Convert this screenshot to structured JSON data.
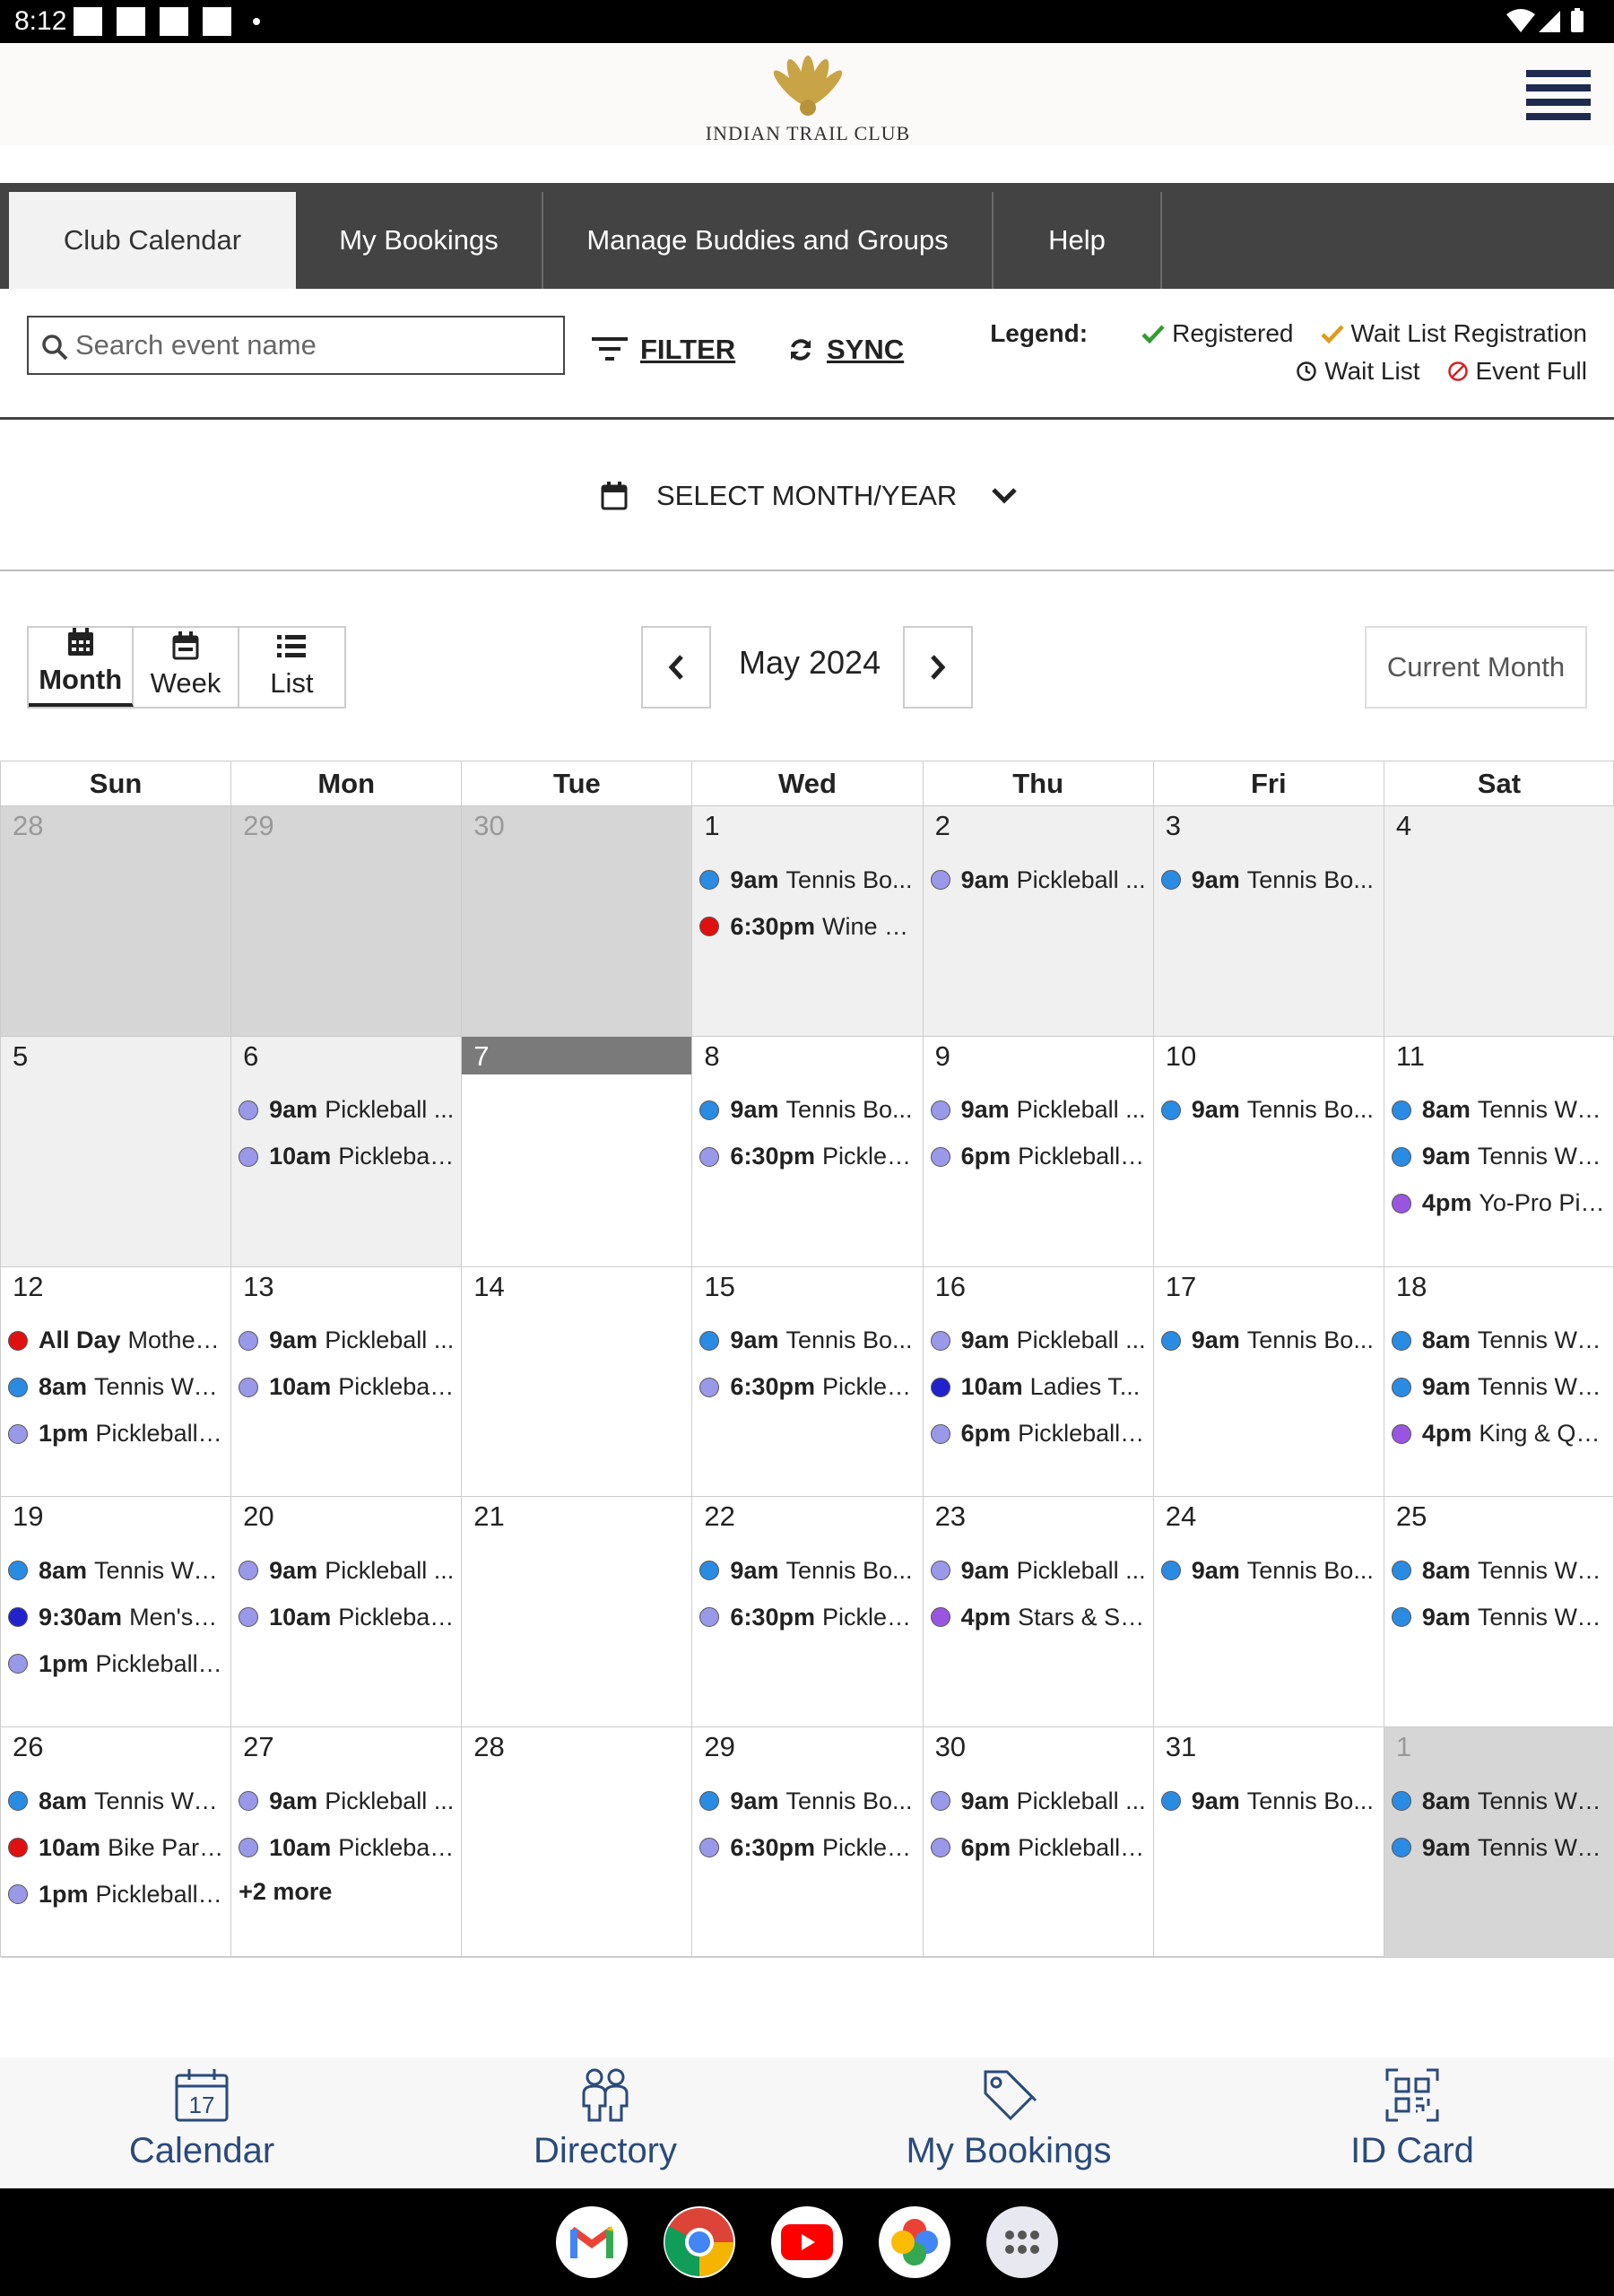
{
  "status_bar": {
    "time": "8:12"
  },
  "header": {
    "logo_text": "INDIAN TRAIL CLUB"
  },
  "tabs": [
    {
      "label": "Club Calendar"
    },
    {
      "label": "My Bookings"
    },
    {
      "label": "Manage Buddies and Groups"
    },
    {
      "label": "Help"
    }
  ],
  "toolbar": {
    "search_placeholder": "Search event name",
    "filter_label": "FILTER",
    "sync_label": "SYNC"
  },
  "legend": {
    "title": "Legend:",
    "items": [
      {
        "label": "Registered",
        "icon": "check-icon",
        "color": "#2e9e2e"
      },
      {
        "label": "Wait List Registration",
        "icon": "check-icon",
        "color": "#e09a1a"
      },
      {
        "label": "Wait List",
        "icon": "clock-icon",
        "color": "#222222"
      },
      {
        "label": "Event Full",
        "icon": "no-entry-icon",
        "color": "#d62020"
      }
    ]
  },
  "month_selector": {
    "label": "SELECT MONTH/YEAR"
  },
  "view_switch": {
    "month": "Month",
    "week": "Week",
    "list": "List"
  },
  "calendar": {
    "current_month": "May 2024",
    "current_month_button": "Current Month",
    "weekdays": [
      "Sun",
      "Mon",
      "Tue",
      "Wed",
      "Thu",
      "Fri",
      "Sat"
    ],
    "colors": {
      "blue": "#2a8be3",
      "lavender": "#9a98e8",
      "red": "#e01010",
      "navy": "#2222cc",
      "purple": "#9a55e0"
    },
    "weeks": [
      [
        {
          "day": "28",
          "outside": true,
          "events": []
        },
        {
          "day": "29",
          "outside": true,
          "events": []
        },
        {
          "day": "30",
          "outside": true,
          "events": []
        },
        {
          "day": "1",
          "events": [
            {
              "time": "9am",
              "title": "Tennis Bo...",
              "color": "blue"
            },
            {
              "time": "6:30pm",
              "title": "Wine D...",
              "color": "red"
            }
          ]
        },
        {
          "day": "2",
          "events": [
            {
              "time": "9am",
              "title": "Pickleball ...",
              "color": "lavender"
            }
          ]
        },
        {
          "day": "3",
          "events": [
            {
              "time": "9am",
              "title": "Tennis Bo...",
              "color": "blue"
            }
          ]
        },
        {
          "day": "4",
          "events": []
        }
      ],
      [
        {
          "day": "5",
          "events": []
        },
        {
          "day": "6",
          "events": [
            {
              "time": "9am",
              "title": "Pickleball ...",
              "color": "lavender"
            },
            {
              "time": "10am",
              "title": "Pickleball...",
              "color": "lavender"
            }
          ]
        },
        {
          "day": "7",
          "today": true,
          "events": []
        },
        {
          "day": "8",
          "events": [
            {
              "time": "9am",
              "title": "Tennis Bo...",
              "color": "blue"
            },
            {
              "time": "6:30pm",
              "title": "Pickleb...",
              "color": "lavender"
            }
          ]
        },
        {
          "day": "9",
          "events": [
            {
              "time": "9am",
              "title": "Pickleball ...",
              "color": "lavender"
            },
            {
              "time": "6pm",
              "title": "Pickleball ...",
              "color": "lavender"
            }
          ]
        },
        {
          "day": "10",
          "events": [
            {
              "time": "9am",
              "title": "Tennis Bo...",
              "color": "blue"
            }
          ]
        },
        {
          "day": "11",
          "events": [
            {
              "time": "8am",
              "title": "Tennis We...",
              "color": "blue"
            },
            {
              "time": "9am",
              "title": "Tennis We...",
              "color": "blue"
            },
            {
              "time": "4pm",
              "title": "Yo-Pro Pic...",
              "color": "purple"
            }
          ]
        }
      ],
      [
        {
          "day": "12",
          "events": [
            {
              "time": "All Day",
              "title": "Mother'...",
              "color": "red"
            },
            {
              "time": "8am",
              "title": "Tennis We...",
              "color": "blue"
            },
            {
              "time": "1pm",
              "title": "Pickleball ...",
              "color": "lavender"
            }
          ]
        },
        {
          "day": "13",
          "events": [
            {
              "time": "9am",
              "title": "Pickleball ...",
              "color": "lavender"
            },
            {
              "time": "10am",
              "title": "Pickleball...",
              "color": "lavender"
            }
          ]
        },
        {
          "day": "14",
          "events": []
        },
        {
          "day": "15",
          "events": [
            {
              "time": "9am",
              "title": "Tennis Bo...",
              "color": "blue"
            },
            {
              "time": "6:30pm",
              "title": "Pickleb...",
              "color": "lavender"
            }
          ]
        },
        {
          "day": "16",
          "events": [
            {
              "time": "9am",
              "title": "Pickleball ...",
              "color": "lavender"
            },
            {
              "time": "10am",
              "title": "Ladies T...",
              "color": "navy"
            },
            {
              "time": "6pm",
              "title": "Pickleball ...",
              "color": "lavender"
            }
          ]
        },
        {
          "day": "17",
          "events": [
            {
              "time": "9am",
              "title": "Tennis Bo...",
              "color": "blue"
            }
          ]
        },
        {
          "day": "18",
          "events": [
            {
              "time": "8am",
              "title": "Tennis We...",
              "color": "blue"
            },
            {
              "time": "9am",
              "title": "Tennis We...",
              "color": "blue"
            },
            {
              "time": "4pm",
              "title": "King & Qu...",
              "color": "purple"
            }
          ]
        }
      ],
      [
        {
          "day": "19",
          "events": [
            {
              "time": "8am",
              "title": "Tennis We...",
              "color": "blue"
            },
            {
              "time": "9:30am",
              "title": "Men's T...",
              "color": "navy"
            },
            {
              "time": "1pm",
              "title": "Pickleball ...",
              "color": "lavender"
            }
          ]
        },
        {
          "day": "20",
          "events": [
            {
              "time": "9am",
              "title": "Pickleball ...",
              "color": "lavender"
            },
            {
              "time": "10am",
              "title": "Pickleball...",
              "color": "lavender"
            }
          ]
        },
        {
          "day": "21",
          "events": []
        },
        {
          "day": "22",
          "events": [
            {
              "time": "9am",
              "title": "Tennis Bo...",
              "color": "blue"
            },
            {
              "time": "6:30pm",
              "title": "Pickleb...",
              "color": "lavender"
            }
          ]
        },
        {
          "day": "23",
          "events": [
            {
              "time": "9am",
              "title": "Pickleball ...",
              "color": "lavender"
            },
            {
              "time": "4pm",
              "title": "Stars & Str...",
              "color": "purple"
            }
          ]
        },
        {
          "day": "24",
          "events": [
            {
              "time": "9am",
              "title": "Tennis Bo...",
              "color": "blue"
            }
          ]
        },
        {
          "day": "25",
          "events": [
            {
              "time": "8am",
              "title": "Tennis We...",
              "color": "blue"
            },
            {
              "time": "9am",
              "title": "Tennis We...",
              "color": "blue"
            }
          ]
        }
      ],
      [
        {
          "day": "26",
          "events": [
            {
              "time": "8am",
              "title": "Tennis We...",
              "color": "blue"
            },
            {
              "time": "10am",
              "title": "Bike Para...",
              "color": "red"
            },
            {
              "time": "1pm",
              "title": "Pickleball ...",
              "color": "lavender"
            }
          ]
        },
        {
          "day": "27",
          "more": "+2 more",
          "events": [
            {
              "time": "9am",
              "title": "Pickleball ...",
              "color": "lavender"
            },
            {
              "time": "10am",
              "title": "Pickleball...",
              "color": "lavender"
            }
          ]
        },
        {
          "day": "28",
          "events": []
        },
        {
          "day": "29",
          "events": [
            {
              "time": "9am",
              "title": "Tennis Bo...",
              "color": "blue"
            },
            {
              "time": "6:30pm",
              "title": "Pickleb...",
              "color": "lavender"
            }
          ]
        },
        {
          "day": "30",
          "events": [
            {
              "time": "9am",
              "title": "Pickleball ...",
              "color": "lavender"
            },
            {
              "time": "6pm",
              "title": "Pickleball ...",
              "color": "lavender"
            }
          ]
        },
        {
          "day": "31",
          "events": [
            {
              "time": "9am",
              "title": "Tennis Bo...",
              "color": "blue"
            }
          ]
        },
        {
          "day": "1",
          "outside": true,
          "events": [
            {
              "time": "8am",
              "title": "Tennis We...",
              "color": "blue"
            },
            {
              "time": "9am",
              "title": "Tennis We...",
              "color": "blue"
            }
          ]
        }
      ]
    ]
  },
  "bottom_nav": {
    "items": [
      {
        "label": "Calendar",
        "icon": "calendar-icon",
        "icon_text": "17"
      },
      {
        "label": "Directory",
        "icon": "people-icon"
      },
      {
        "label": "My Bookings",
        "icon": "tag-icon"
      },
      {
        "label": "ID Card",
        "icon": "qr-code-icon"
      }
    ]
  },
  "dock": {
    "apps": [
      "gmail",
      "chrome",
      "youtube",
      "photos",
      "app-drawer"
    ]
  }
}
